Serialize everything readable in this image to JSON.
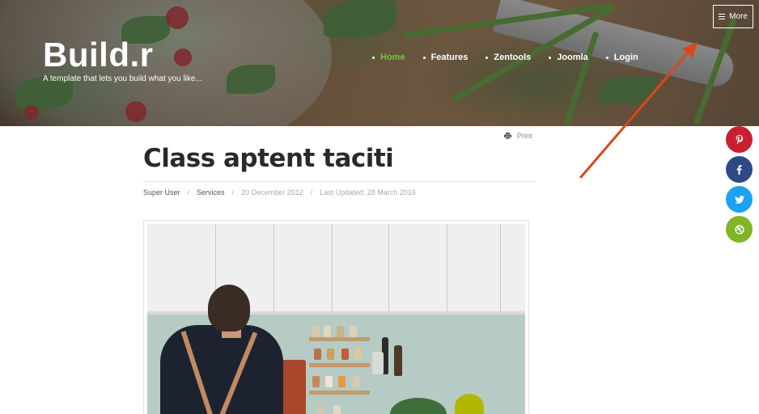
{
  "header": {
    "site_title": "Build.r",
    "tagline": "A template that lets you build what you like...",
    "more_label": "More"
  },
  "nav": {
    "items": [
      {
        "label": "Home",
        "active": true
      },
      {
        "label": "Features",
        "active": false
      },
      {
        "label": "Zentools",
        "active": false
      },
      {
        "label": "Joomla",
        "active": false
      },
      {
        "label": "Login",
        "active": false
      }
    ]
  },
  "article": {
    "print_label": "Print",
    "title": "Class aptent taciti",
    "meta": {
      "author": "Super User",
      "category": "Services",
      "date": "20 December 2012",
      "last_updated": "Last Updated: 28 March 2016"
    }
  },
  "social": {
    "buttons": [
      {
        "icon": "pinterest-icon",
        "color": "#c8202f"
      },
      {
        "icon": "facebook-icon",
        "color": "#2d4a86"
      },
      {
        "icon": "twitter-icon",
        "color": "#1da1f2"
      },
      {
        "icon": "dribbble-icon",
        "color": "#7fb526"
      }
    ]
  },
  "colors": {
    "accent": "#7bc043",
    "annotation_arrow": "#d9481b"
  }
}
